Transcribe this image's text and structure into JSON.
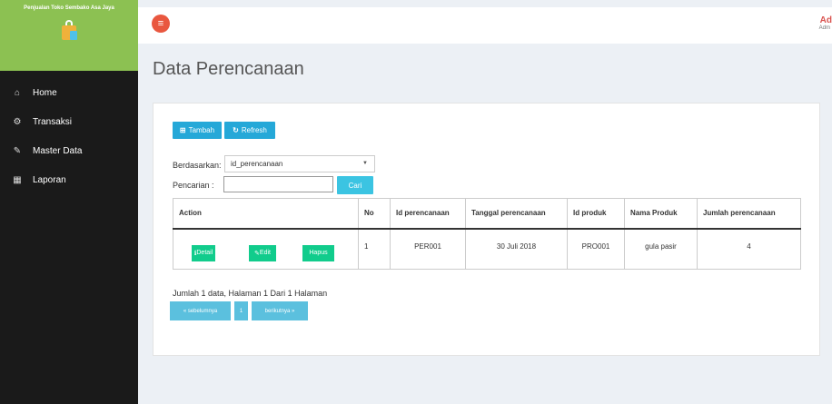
{
  "sidebar": {
    "brand": "Penjualan Toko Sembako Asa Jaya",
    "items": [
      {
        "label": "Home"
      },
      {
        "label": "Transaksi"
      },
      {
        "label": "Master Data"
      },
      {
        "label": "Laporan"
      }
    ]
  },
  "topbar": {
    "menu_icon": "≡",
    "user_name": "Ad",
    "user_role": "Adm"
  },
  "page": {
    "title": "Data Perencanaan"
  },
  "toolbar": {
    "tambah": "Tambah",
    "refresh": "Refresh"
  },
  "filter": {
    "label": "Berdasarkan:",
    "selected": "id_perencanaan"
  },
  "search": {
    "label": "Pencarian   :",
    "value": "",
    "button": "Cari"
  },
  "table": {
    "headers": [
      "Action",
      "No",
      "Id perencanaan",
      "Tanggal perencanaan",
      "Id produk",
      "Nama Produk",
      "Jumlah perencanaan"
    ],
    "rows": [
      {
        "actions": {
          "detail": "Detail",
          "edit": "Edit",
          "hapus": "Hapus"
        },
        "no": "1",
        "id_perencanaan": "PER001",
        "tanggal": "30 Juli 2018",
        "id_produk": "PRO001",
        "nama_produk": "gula pasir",
        "jumlah": "4"
      }
    ]
  },
  "summary": "Jumlah 1 data, Halaman 1 Dari 1 Halaman",
  "pagination": {
    "prev": "« sebelumnya",
    "current": "1",
    "next": "berikutnya »"
  },
  "colors": {
    "brand": "#8cc152",
    "primary": "#25a8d8",
    "success": "#11cc8c",
    "danger": "#e9573f"
  }
}
